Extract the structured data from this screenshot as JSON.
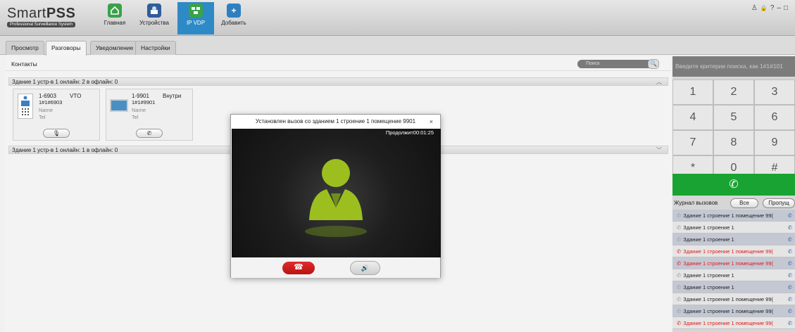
{
  "app": {
    "name_light": "Smart",
    "name_bold": "PSS",
    "subtitle": "Professional Surveillance System"
  },
  "toolbar": {
    "items": [
      {
        "label": "Главная",
        "icon": "home-icon",
        "active": false
      },
      {
        "label": "Устройства",
        "icon": "devices-icon",
        "active": false
      },
      {
        "label": "IP VDP",
        "icon": "ip-vdp-icon",
        "active": true
      },
      {
        "label": "Добавить",
        "icon": "add-icon",
        "active": false
      }
    ]
  },
  "window_controls": {
    "user": "♙",
    "lock": "🔒",
    "help": "?",
    "min": "–",
    "restore": "□"
  },
  "tabs": [
    "Просмотр",
    "Разговоры",
    "Уведомление",
    "Настройки"
  ],
  "contacts": {
    "title": "Контакты",
    "search_placeholder": "Поиск",
    "groups": [
      {
        "label": "Здание 1 устр-в 1 онлайн: 2 в офлайн: 0",
        "state": "expanded"
      },
      {
        "label": "Здание 1 устр-в 1 онлайн: 1 в офлайн: 0",
        "state": "collapsed"
      }
    ],
    "cards": [
      {
        "number": "1-6903",
        "type": "VTO",
        "id": "1#1#6903",
        "name": "Name",
        "tel": "Tel",
        "action": "mic"
      },
      {
        "number": "1-9901",
        "type": "Внутри",
        "id": "1#1#9901",
        "name": "Name",
        "tel": "Tel",
        "action": "phone"
      }
    ]
  },
  "dialog": {
    "title": "Установлен вызов со зданием 1 строение 1 помещение 9901",
    "close": "×",
    "duration": "Продолжит00:01:25"
  },
  "dialer": {
    "search_placeholder": "Введите критерии поиска, как 1#1#101",
    "keys": [
      "1",
      "2",
      "3",
      "4",
      "5",
      "6",
      "7",
      "8",
      "9",
      "*",
      "0",
      "#"
    ],
    "call_icon": "phone-icon",
    "call_color": "#19a332"
  },
  "call_log": {
    "title": "Журнал вызовов",
    "filter_all": "Все",
    "filter_missed": "Пропущ",
    "rows": [
      {
        "text": "Здание 1 строение 1 помещение 99(",
        "missed": false
      },
      {
        "text": "Здание 1 строение 1",
        "missed": false
      },
      {
        "text": "Здание 1 строение 1",
        "missed": false
      },
      {
        "text": "Здание 1 строение 1 помещение 99(",
        "missed": true
      },
      {
        "text": "Здание 1 строение 1 помещение 99(",
        "missed": true
      },
      {
        "text": "Здание 1 строение 1",
        "missed": false
      },
      {
        "text": "Здание 1 строение 1",
        "missed": false
      },
      {
        "text": "Здание 1 строение 1 помещение 99(",
        "missed": false
      },
      {
        "text": "Здание 1 строение 1 помещение 99(",
        "missed": false
      },
      {
        "text": "Здание 1 строение 1 помещение 99(",
        "missed": true
      }
    ]
  }
}
